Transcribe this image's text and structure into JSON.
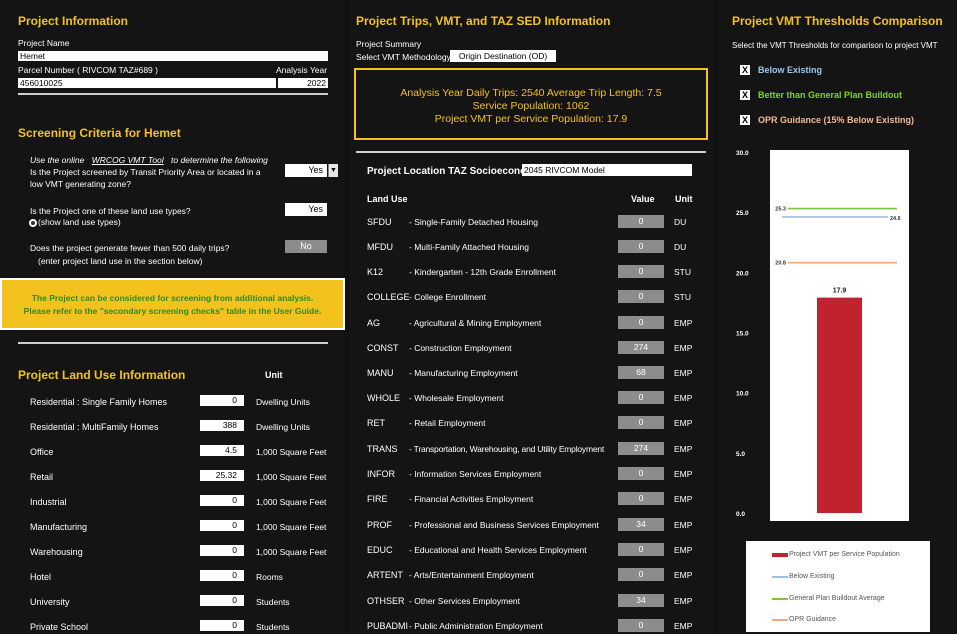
{
  "colors": {
    "accent": "#f4c21c",
    "bar": "#c0222e",
    "below_existing": "#a3bde6",
    "general_plan": "#7cc440",
    "opr": "#f2a77c",
    "green_text": "#7ed321",
    "blue_text": "#9ec6f2",
    "orange_text": "#f5b98d"
  },
  "left": {
    "title": "Project Information",
    "project_name_label": "Project Name",
    "project_name": "Hemet",
    "parcel_label": "Parcel Number ( RIVCOM TAZ#689 )",
    "analysis_year_label": "Analysis Year",
    "parcel": "456010025",
    "analysis_year": "2022",
    "screening_title": "Screening Criteria for Hemet",
    "tool_prefix": "Use the online",
    "tool_link": "WRCOG VMT Tool",
    "tool_suffix": "to determine the following",
    "q1_line1": "Is the Project screened by Transit Priority Area or located in a",
    "q1_line2": "low VMT generating zone?",
    "q1_answer": "Yes",
    "q2": "Is the Project one of these land use types?",
    "q2_answer": "Yes",
    "q2_link": "(show land use types)",
    "q3": "Does the project generate fewer than 500 daily trips?",
    "q3_sub": "(enter project land use in the section below)",
    "q3_answer": "No",
    "banner_line1": "The Project can be considered for screening from additional analysis.",
    "banner_line2": "Please refer to the \"secondary screening checks\" table in the User Guide.",
    "land_use_title": "Project Land Use Information",
    "unit_header": "Unit",
    "land_uses": [
      {
        "name": "Residential : Single Family Homes",
        "value": "0",
        "unit": "Dwelling Units"
      },
      {
        "name": "Residential : MultiFamily Homes",
        "value": "388",
        "unit": "Dwelling Units"
      },
      {
        "name": "Office",
        "value": "4.5",
        "unit": "1,000 Square Feet"
      },
      {
        "name": "Retail",
        "value": "25.32",
        "unit": "1,000 Square Feet"
      },
      {
        "name": "Industrial",
        "value": "0",
        "unit": "1,000 Square Feet"
      },
      {
        "name": "Manufacturing",
        "value": "0",
        "unit": "1,000 Square Feet"
      },
      {
        "name": "Warehousing",
        "value": "0",
        "unit": "1,000 Square Feet"
      },
      {
        "name": "Hotel",
        "value": "0",
        "unit": "Rooms"
      },
      {
        "name": "University",
        "value": "0",
        "unit": "Students"
      },
      {
        "name": "Private School",
        "value": "0",
        "unit": "Students"
      }
    ]
  },
  "mid": {
    "title": "Project Trips, VMT, and TAZ SED Information",
    "summary_label": "Project Summary",
    "methodology_label": "Select VMT Methodology",
    "methodology_value": "Origin Destination (OD)",
    "summary_line1": "Analysis Year Daily Trips: 2540    Average Trip Length: 7.5",
    "summary_line2": "Service Population: 1062",
    "summary_line3": "Project VMT per Service Population: 17.9",
    "taz_title": "Project Location TAZ Socioeconomi",
    "taz_model": "2045 RIVCOM Model",
    "col_land_use": "Land Use",
    "col_value": "Value",
    "col_unit": "Unit",
    "rows": [
      {
        "code": "SFDU",
        "desc": "-  Single-Family Detached Housing",
        "value": "0",
        "unit": "DU"
      },
      {
        "code": "MFDU",
        "desc": "-  Multi-Family Attached Housing",
        "value": "0",
        "unit": "DU"
      },
      {
        "code": "K12",
        "desc": "-  Kindergarten - 12th Grade Enrollment",
        "value": "0",
        "unit": "STU"
      },
      {
        "code": "COLLEGE",
        "desc": "-  College Enrollment",
        "value": "0",
        "unit": "STU"
      },
      {
        "code": "AG",
        "desc": "-  Agricultural & Mining Employment",
        "value": "0",
        "unit": "EMP"
      },
      {
        "code": "CONST",
        "desc": "-  Construction Employment",
        "value": "274",
        "unit": "EMP"
      },
      {
        "code": "MANU",
        "desc": "-  Manufacturing Employment",
        "value": "68",
        "unit": "EMP"
      },
      {
        "code": "WHOLE",
        "desc": "-  Wholesale Employment",
        "value": "0",
        "unit": "EMP"
      },
      {
        "code": "RET",
        "desc": "-  Retail Employment",
        "value": "0",
        "unit": "EMP"
      },
      {
        "code": "TRANS",
        "desc": "-  Transportation, Warehousing, and Utility Employment",
        "value": "274",
        "unit": "EMP"
      },
      {
        "code": "INFOR",
        "desc": "-  Information Services Employment",
        "value": "0",
        "unit": "EMP"
      },
      {
        "code": "FIRE",
        "desc": "-  Financial Activities Employment",
        "value": "0",
        "unit": "EMP"
      },
      {
        "code": "PROF",
        "desc": "-  Professional and Business Services Employment",
        "value": "34",
        "unit": "EMP"
      },
      {
        "code": "EDUC",
        "desc": "-  Educational and Health Services Employment",
        "value": "0",
        "unit": "EMP"
      },
      {
        "code": "ARTENT",
        "desc": "-  Arts/Entertainment Employment",
        "value": "0",
        "unit": "EMP"
      },
      {
        "code": "OTHSER",
        "desc": "-  Other Services Employment",
        "value": "34",
        "unit": "EMP"
      },
      {
        "code": "PUBADMI",
        "desc": "-  Public Administration Employment",
        "value": "0",
        "unit": "EMP"
      }
    ]
  },
  "right": {
    "title": "Project VMT Thresholds Comparison",
    "subtitle": "Select the VMT Thresholds for comparison to project VMT",
    "checks": [
      {
        "mark": "X",
        "label": "Below Existing"
      },
      {
        "mark": "X",
        "label": "Better than General Plan Buildout"
      },
      {
        "mark": "X",
        "label": "OPR Guidance (15% Below Existing)"
      }
    ]
  },
  "chart_data": {
    "type": "bar",
    "categories": [
      ""
    ],
    "values": [
      17.9
    ],
    "ylim": [
      0,
      30
    ],
    "yticks": [
      "0.0",
      "5.0",
      "10.0",
      "15.0",
      "20.0",
      "25.0",
      "30.0"
    ],
    "data_label": "17.9",
    "series": [
      {
        "name": "Project VMT per Service Population",
        "values": [
          17.9
        ]
      },
      {
        "name": "Below Existing",
        "values": [
          24.6
        ],
        "label": "24.6"
      },
      {
        "name": "General Plan Buildout Average",
        "values": [
          25.3
        ],
        "label": "25.3"
      },
      {
        "name": "OPR Guidance",
        "values": [
          20.8
        ],
        "label": "20.8"
      }
    ],
    "legend_position": "bottom"
  }
}
